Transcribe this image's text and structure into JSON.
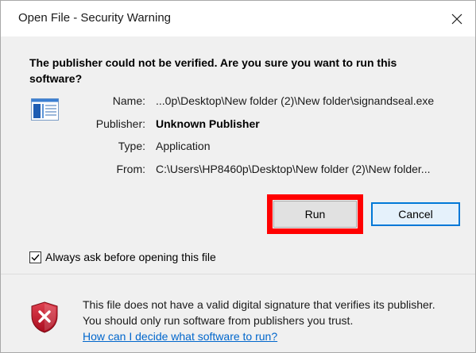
{
  "window": {
    "title": "Open File - Security Warning"
  },
  "question": "The publisher could not be verified.  Are you sure you want to run this software?",
  "info": {
    "name_label": "Name:",
    "name_value": "...0p\\Desktop\\New folder (2)\\New folder\\signandseal.exe",
    "publisher_label": "Publisher:",
    "publisher_value": "Unknown Publisher",
    "type_label": "Type:",
    "type_value": "Application",
    "from_label": "From:",
    "from_value": "C:\\Users\\HP8460p\\Desktop\\New folder (2)\\New folder..."
  },
  "buttons": {
    "run_label": "Run",
    "cancel_label": "Cancel"
  },
  "checkbox": {
    "label": "Always ask before opening this file",
    "checked": true
  },
  "footer": {
    "message": "This file does not have a valid digital signature that verifies its publisher.  You should only run software from publishers you trust.",
    "link_text": "How can I decide what software to run?"
  },
  "icons": {
    "close": "close-icon",
    "file": "application-file-icon",
    "shield": "security-shield-icon",
    "check": "checkmark-icon"
  },
  "colors": {
    "highlight": "#ff0000",
    "link": "#0066cc",
    "default_button_border": "#0078d7",
    "shield_red": "#c8102e"
  }
}
